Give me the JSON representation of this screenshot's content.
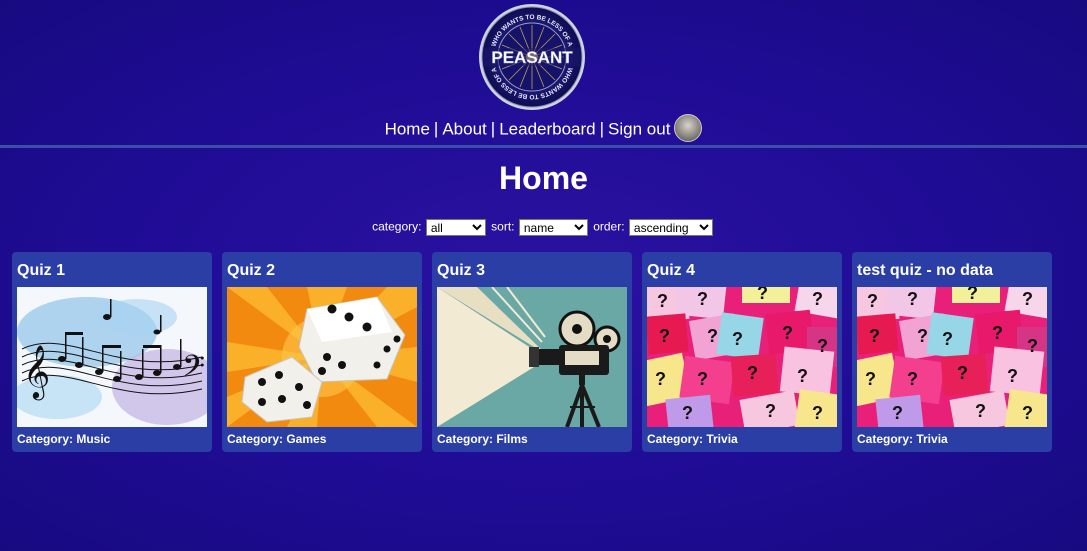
{
  "logo": {
    "text": "PEASANT",
    "ring_text_top": "WHO WANTS TO BE LESS OF A",
    "ring_text_bottom": "WHO WANTS TO BE LESS OF A"
  },
  "nav": {
    "items": [
      {
        "label": "Home"
      },
      {
        "label": "About"
      },
      {
        "label": "Leaderboard"
      },
      {
        "label": "Sign out"
      }
    ],
    "separator": "|"
  },
  "page": {
    "title": "Home"
  },
  "controls": {
    "category_label": "category:",
    "category_value": "all",
    "sort_label": "sort:",
    "sort_value": "name",
    "order_label": "order:",
    "order_value": "ascending"
  },
  "quizzes": [
    {
      "title": "Quiz 1",
      "category": "Category: Music",
      "image": "music-notes-image"
    },
    {
      "title": "Quiz 2",
      "category": "Category: Games",
      "image": "dice-image"
    },
    {
      "title": "Quiz 3",
      "category": "Category: Films",
      "image": "film-projector-image"
    },
    {
      "title": "Quiz 4",
      "category": "Category: Trivia",
      "image": "question-marks-image"
    },
    {
      "title": "test quiz - no data",
      "category": "Category: Trivia",
      "image": "question-marks-image"
    }
  ],
  "colors": {
    "background": "#1f0c95",
    "card": "#2a3ea6",
    "divider": "#3a4fa8"
  }
}
